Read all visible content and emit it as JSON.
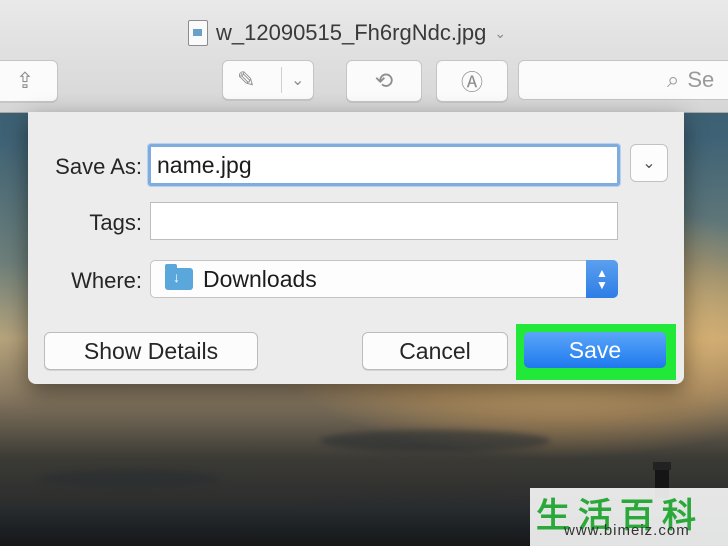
{
  "window": {
    "title": "w_12090515_Fh6rgNdc.jpg",
    "search_placeholder": "Se"
  },
  "dialog": {
    "save_as_label": "Save As:",
    "save_as_value": "name.jpg",
    "tags_label": "Tags:",
    "tags_value": "",
    "where_label": "Where:",
    "where_value": "Downloads",
    "show_details_label": "Show Details",
    "cancel_label": "Cancel",
    "save_label": "Save"
  },
  "watermark": {
    "brand": "生活百科",
    "url": "www.bimeiz.com"
  },
  "colors": {
    "accent": "#2f7de6",
    "highlight": "#22e83a"
  }
}
